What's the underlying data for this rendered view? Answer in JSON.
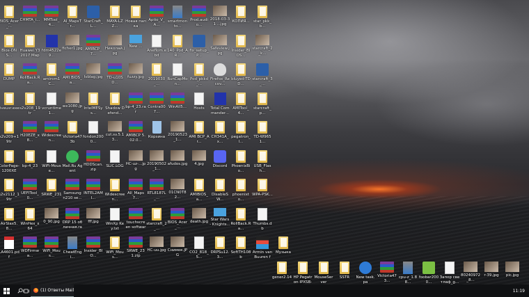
{
  "desktop": {
    "rows": [
      [
        [
          "BIOS_Acer_...",
          "folder"
        ],
        [
          "CHMTA_i...",
          "rar"
        ],
        [
          "MMTool_4...",
          "rar"
        ],
        [
          "AI_MapsTr...",
          "folder"
        ],
        [
          "StarCraft_L...",
          "app"
        ],
        [
          "MAYA-LZZ...",
          "folder"
        ],
        [
          "Новая папка",
          "folder"
        ],
        [
          "Aptio_V_A...",
          "rar"
        ],
        [
          "smartmonto...",
          "installer"
        ],
        [
          "Prod.audio...",
          "rar"
        ],
        [
          "2018-03-31 ...jpg",
          "image"
        ],
        [
          "КОПИЯ...",
          "folder"
        ],
        [
          "star_pkk_b...",
          "folder"
        ]
      ],
      [
        [
          "Bios-DNS...",
          "folder"
        ],
        [
          "Huawei Y3 2017 Maps...",
          "folder"
        ],
        [
          "fdm4522e9...",
          "floppy"
        ],
        [
          "ficher1.jpg",
          "image"
        ],
        [
          "AMIBCP_7...",
          "rar"
        ],
        [
          "Николай.jpg",
          "image"
        ],
        [
          "New ...",
          "monitor"
        ],
        [
          "Aneflom.ebd",
          "file"
        ],
        [
          "140_Pod_AR...",
          "folder"
        ],
        [
          "fix_setup_P...",
          "app"
        ],
        [
          "Safeview.jpg",
          "image"
        ],
        [
          "Insider_BIOS...",
          "folder"
        ],
        [
          "starcraft_2_k...",
          "image"
        ]
      ],
      [
        [
          "DUMP",
          "folder"
        ],
        [
          "RollBack.Ra...",
          "rar"
        ],
        [
          "amirom1C...",
          "folder"
        ],
        [
          "AMI BIOS_a...",
          "rar"
        ],
        [
          "Ivblag.jpg",
          "image"
        ],
        [
          "TD-u10SD...",
          "rar"
        ],
        [
          "fuzzy.jpg",
          "image"
        ],
        [
          "2019030_...",
          "folder"
        ],
        [
          "RunCapMon...",
          "file"
        ],
        [
          "Pod_pkkd_...",
          "folder"
        ],
        [
          "Firefox_Recov...",
          "alien"
        ],
        [
          "bluyed-TDD...",
          "folder"
        ],
        [
          "starcraft_3_...",
          "app"
        ]
      ],
      [
        [
          "liveusr.exe",
          "folder"
        ],
        [
          "s2v208_19tr",
          "folder"
        ],
        [
          "vcruntime1...",
          "file"
        ],
        [
          "wx1080.jpg",
          "image"
        ],
        [
          "IntelMESys...",
          "folder"
        ],
        [
          "Shadow Defend...",
          "folder"
        ],
        [
          "bp-4_23.rar",
          "rar"
        ],
        [
          "Contra007...",
          "rar"
        ],
        [
          "WinAll5...",
          "rar"
        ],
        [
          "Hosts",
          "file"
        ],
        [
          "Total Commander...",
          "floppy"
        ],
        [
          "AMITool_4...",
          "folder"
        ],
        [
          "starcraft_p...",
          "folder"
        ]
      ],
      [
        [
          "s2v209+19tr",
          "folder"
        ],
        [
          "H20EZE_x8...",
          "rar"
        ],
        [
          "Widescreen...",
          "rar"
        ],
        [
          "Victoria473b",
          "folder"
        ],
        [
          "fondon2000...",
          "file"
        ],
        [
          "cut.sv.5.13...",
          "image"
        ],
        [
          "AMIBCP 5.02.0...",
          "rar"
        ],
        [
          "Корзина",
          "recycle"
        ],
        [
          "20190523_1...",
          "image"
        ],
        [
          "AMI BCP_Ar...",
          "folder"
        ],
        [
          "CH341A_x...",
          "folder"
        ],
        [
          "pegatron_l...",
          "folder"
        ],
        [
          "TD-W9651...",
          "folder"
        ]
      ],
      [
        [
          "ColorPage-1200XE",
          "folder"
        ],
        [
          "bp-4_23",
          "folder"
        ],
        [
          "WiFi-Mouse...",
          "file"
        ],
        [
          "Mail.Ru Agent",
          "green"
        ],
        [
          "HDDScan.zip",
          "rar"
        ],
        [
          "SLIC.LOG",
          "file"
        ],
        [
          "HC-uz-...jpg",
          "image"
        ],
        [
          "20190502_1...",
          "image"
        ],
        [
          "afudos.jpg",
          "image"
        ],
        [
          "4.jpg",
          "image"
        ],
        [
          "Discord",
          "discord"
        ],
        [
          "PhoenixBio...",
          "folder"
        ],
        [
          "USB_Flash...",
          "folder"
        ]
      ],
      [
        [
          "s2v2112_19tr",
          "folder"
        ],
        [
          "UEFITool_0...",
          "rar"
        ],
        [
          "SRWE_231",
          "folder"
        ],
        [
          "Samsung n210 se...",
          "rar"
        ],
        [
          "INTEL2AMI...",
          "rar"
        ],
        [
          "Widescreen...",
          "folder"
        ],
        [
          "All_Maps7...",
          "rar"
        ],
        [
          "RTL8187L_...",
          "rar"
        ],
        [
          "01CN0T82...",
          "image"
        ],
        [
          "AMIBIOS_a...",
          "folder"
        ],
        [
          "DisableSW...",
          "folder"
        ],
        [
          "phoenixto...",
          "folder"
        ],
        [
          "WPA-PSK...",
          "folder"
        ]
      ],
      [
        [
          "AirSlax5.8...",
          "folder"
        ],
        [
          "WinHex_x64",
          "folder"
        ],
        [
          "0_90.jpg",
          "image"
        ],
        [
          "DRP 15 облачная.rar",
          "rar"
        ],
        [
          "fff.jpg",
          "image"
        ],
        [
          "WinXp Key.txt",
          "file"
        ],
        [
          "touchscreen software.rar",
          "rar"
        ],
        [
          "starcraft_2_...",
          "folder"
        ],
        [
          "BIOS_Acer_...",
          "rar"
        ],
        [
          "death.jpg",
          "image"
        ],
        [
          "Star Wars - Knights...",
          "monitor"
        ],
        [
          "RollBack.Ra...",
          "folder"
        ],
        [
          "Thumbs.db",
          "file"
        ]
      ],
      [
        [
          "LA4601.pdf",
          "pdf"
        ],
        [
          "WDFirmwa...",
          "rar"
        ],
        [
          "WiFi_Mous...",
          "rar"
        ],
        [
          "CheatEngi...",
          "installer"
        ],
        [
          "Insider_BIO...",
          "rar"
        ],
        [
          "WiFi_Mous...",
          "folder"
        ],
        [
          "SRWE_231.zip",
          "rar"
        ],
        [
          "HC-uu.jpg",
          "image"
        ],
        [
          "Снимок.JPG",
          "image"
        ],
        [
          "CO2_818_5...",
          "file"
        ],
        [
          "DRPSu12.3...",
          "folder"
        ],
        [
          "SoftTH108b",
          "folder"
        ],
        [
          "Armin van Buuren fe...",
          "media"
        ],
        [
          "Музыка",
          "folder"
        ]
      ]
    ],
    "bottom_row": [
      [
        "gener2.14",
        "folder"
      ],
      [
        "HP Pegatron IPXSB-DM...",
        "folder"
      ],
      [
        "MouseServer",
        "folder"
      ],
      [
        "SSTR",
        "folder"
      ],
      [
        "New task.pa",
        "gear"
      ],
      [
        "Victoria473...",
        "rar"
      ],
      [
        "cpu-z_1.88...",
        "installer"
      ],
      [
        "foobar2000...",
        "alien-green"
      ],
      [
        "Запор светлаф_g...",
        "file"
      ],
      [
        "80240972_8...",
        "image"
      ],
      [
        "r-39.jpg",
        "image"
      ],
      [
        "pic.jpg",
        "image"
      ]
    ]
  },
  "taskbar": {
    "start_icon": "windows-logo-icon",
    "search_icon": "search-icon",
    "taskview_icon": "task-view-icon",
    "app_title": "(1) Ответы Mail.ru: К...",
    "clock": "11:19"
  }
}
